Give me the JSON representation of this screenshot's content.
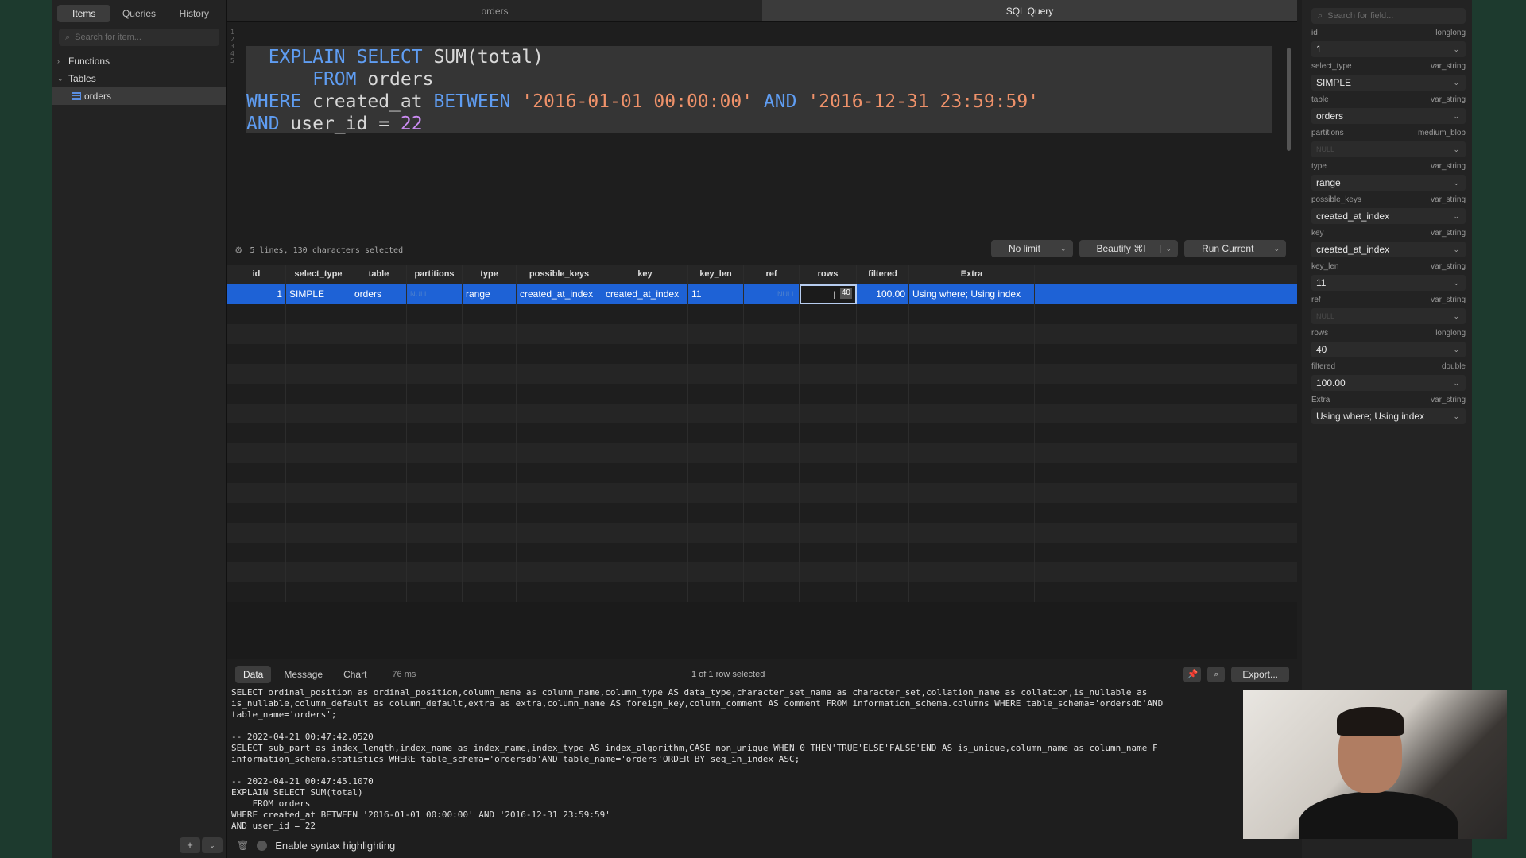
{
  "sidebar": {
    "tabs": [
      "Items",
      "Queries",
      "History"
    ],
    "search_placeholder": "Search for item...",
    "tree": [
      {
        "label": "Functions",
        "level": 0
      },
      {
        "label": "Tables",
        "level": 0
      },
      {
        "label": "orders",
        "level": 1
      }
    ]
  },
  "tabs": [
    "orders",
    "SQL Query"
  ],
  "editor": {
    "line_numbers": [
      "1",
      "2",
      "3",
      "4",
      "5"
    ],
    "status": "5 lines, 130 characters selected",
    "buttons": [
      "No limit",
      "Beautify ⌘I",
      "Run Current"
    ]
  },
  "query": {
    "kw_explain": "EXPLAIN",
    "kw_select": "SELECT",
    "func": "SUM(total)",
    "kw_from": "FROM",
    "table": "orders",
    "kw_where": "WHERE",
    "col1": "created_at",
    "kw_between": "BETWEEN",
    "date_start": "'2016-01-01 00:00:00'",
    "kw_and": "AND",
    "date_end": "'2016-12-31 23:59:59'",
    "col2": "user_id",
    "op": "=",
    "user_id": "22"
  },
  "grid": {
    "columns": [
      "id",
      "select_type",
      "table",
      "partitions",
      "type",
      "possible_keys",
      "key",
      "key_len",
      "ref",
      "rows",
      "filtered",
      "Extra"
    ],
    "row": {
      "id": "1",
      "select_type": "SIMPLE",
      "table": "orders",
      "partitions": "NULL",
      "type": "range",
      "possible_keys": "created_at_index",
      "key": "created_at_index",
      "key_len": "11",
      "ref": "NULL",
      "rows": "40",
      "filtered": "100.00",
      "extra": "Using where; Using index"
    }
  },
  "bottom": {
    "tabs": [
      "Data",
      "Message",
      "Chart"
    ],
    "elapsed": "76 ms",
    "selection": "1 of 1 row selected",
    "export": "Export..."
  },
  "log": [
    "SELECT ordinal_position as ordinal_position,column_name as column_name,column_type AS data_type,character_set_name as character_set,collation_name as collation,is_nullable as",
    "is_nullable,column_default as column_default,extra as extra,column_name AS foreign_key,column_comment AS comment FROM information_schema.columns WHERE table_schema='ordersdb'AND",
    "table_name='orders';",
    "",
    "-- 2022-04-21 00:47:42.0520",
    "SELECT sub_part as index_length,index_name as index_name,index_type AS index_algorithm,CASE non_unique WHEN 0 THEN'TRUE'ELSE'FALSE'END AS is_unique,column_name as column_name F",
    "information_schema.statistics WHERE table_schema='ordersdb'AND table_name='orders'ORDER BY seq_in_index ASC;",
    "",
    "-- 2022-04-21 00:47:45.1070",
    "EXPLAIN SELECT SUM(total)",
    "    FROM orders",
    "WHERE created_at BETWEEN '2016-01-01 00:00:00' AND '2016-12-31 23:59:59'",
    "AND user_id = 22"
  ],
  "log_footer": "Enable syntax highlighting",
  "inspector": {
    "search_placeholder": "Search for field...",
    "fields": [
      {
        "name": "id",
        "type": "longlong",
        "value": "1"
      },
      {
        "name": "select_type",
        "type": "var_string",
        "value": "SIMPLE"
      },
      {
        "name": "table",
        "type": "var_string",
        "value": "orders"
      },
      {
        "name": "partitions",
        "type": "medium_blob",
        "value": "NULL"
      },
      {
        "name": "type",
        "type": "var_string",
        "value": "range"
      },
      {
        "name": "possible_keys",
        "type": "var_string",
        "value": "created_at_index"
      },
      {
        "name": "key",
        "type": "var_string",
        "value": "created_at_index"
      },
      {
        "name": "key_len",
        "type": "var_string",
        "value": "11"
      },
      {
        "name": "ref",
        "type": "var_string",
        "value": "NULL"
      },
      {
        "name": "rows",
        "type": "longlong",
        "value": "40"
      },
      {
        "name": "filtered",
        "type": "double",
        "value": "100.00"
      },
      {
        "name": "Extra",
        "type": "var_string",
        "value": "Using where; Using index"
      }
    ]
  },
  "colors": {
    "selection": "#1e62d6",
    "keyword": "#5f9df2",
    "string": "#f0926a",
    "number": "#c98af0",
    "null": "#4f82cc"
  }
}
